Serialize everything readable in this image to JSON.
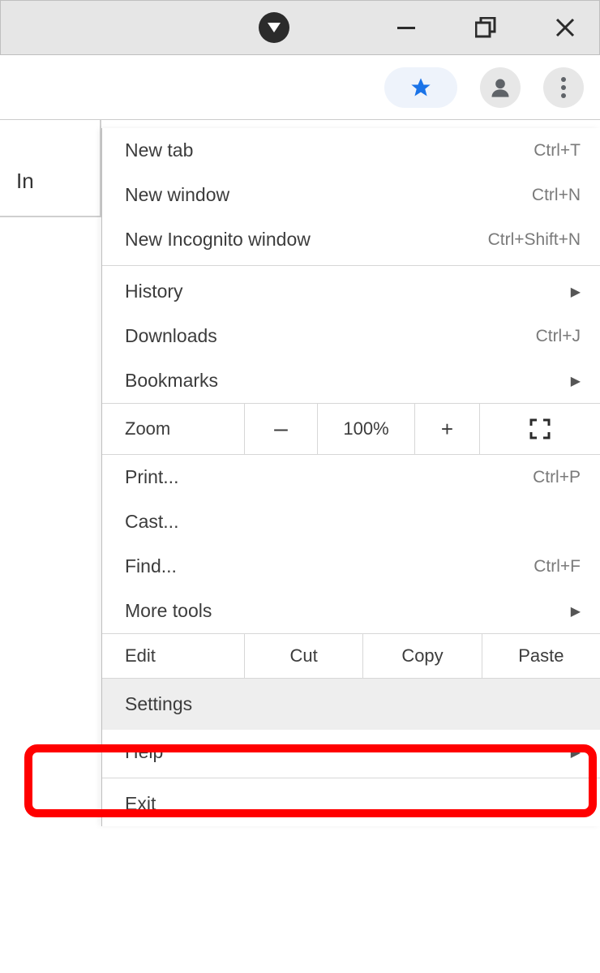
{
  "page_text_fragment": "In",
  "menu": {
    "items": [
      {
        "label": "New tab",
        "shortcut": "Ctrl+T"
      },
      {
        "label": "New window",
        "shortcut": "Ctrl+N"
      },
      {
        "label": "New Incognito window",
        "shortcut": "Ctrl+Shift+N"
      }
    ],
    "history": {
      "label": "History"
    },
    "downloads": {
      "label": "Downloads",
      "shortcut": "Ctrl+J"
    },
    "bookmarks": {
      "label": "Bookmarks"
    },
    "zoom": {
      "label": "Zoom",
      "minus": "–",
      "value": "100%",
      "plus": "+"
    },
    "print": {
      "label": "Print...",
      "shortcut": "Ctrl+P"
    },
    "cast": {
      "label": "Cast..."
    },
    "find": {
      "label": "Find...",
      "shortcut": "Ctrl+F"
    },
    "more_tools": {
      "label": "More tools"
    },
    "edit": {
      "label": "Edit",
      "cut": "Cut",
      "copy": "Copy",
      "paste": "Paste"
    },
    "settings": {
      "label": "Settings"
    },
    "help": {
      "label": "Help"
    },
    "exit": {
      "label": "Exit"
    }
  }
}
